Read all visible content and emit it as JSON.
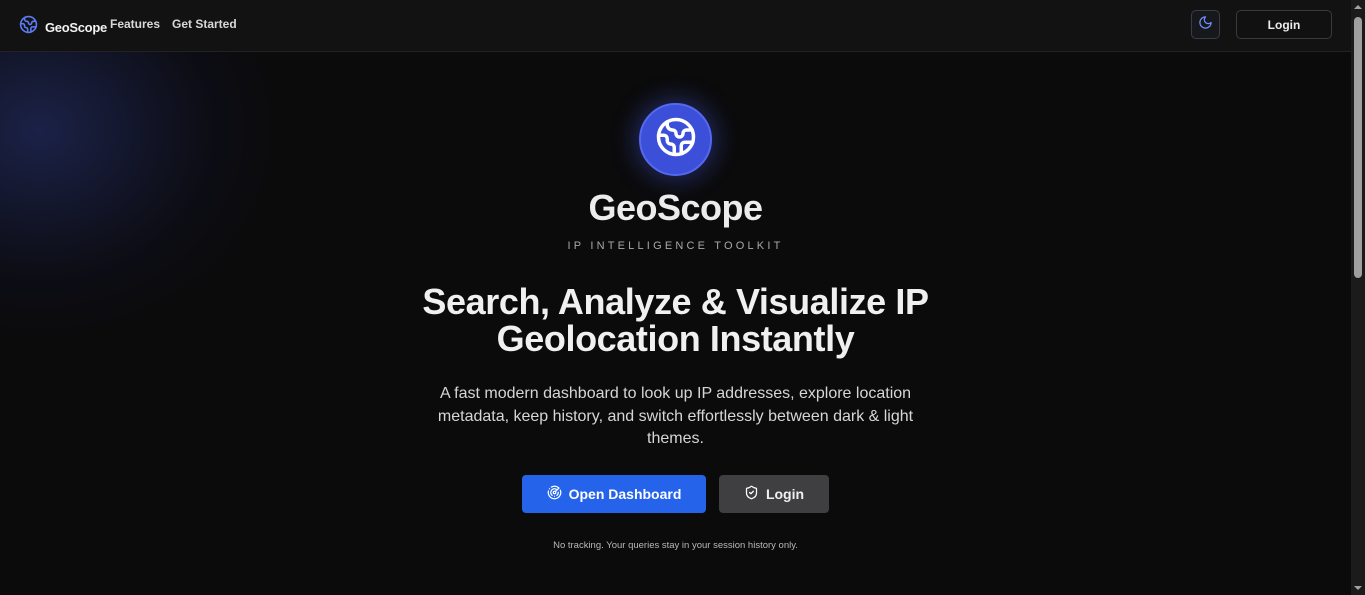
{
  "nav": {
    "brand_name": "GeoScope",
    "links": [
      {
        "label": "Features"
      },
      {
        "label": "Get Started"
      }
    ],
    "theme_toggle_icon": "moon-icon",
    "login_label": "Login"
  },
  "hero": {
    "logo_icon": "globe-icon",
    "title": "GeoScope",
    "tagline": "IP INTELLIGENCE TOOLKIT",
    "headline_line1": "Search, Analyze & Visualize IP",
    "headline_line2": "Geolocation Instantly",
    "description": "A fast modern dashboard to look up IP addresses, explore location metadata, keep history, and switch effortlessly between dark & light themes.",
    "primary_button": {
      "label": "Open Dashboard",
      "icon": "radar-icon"
    },
    "secondary_button": {
      "label": "Login",
      "icon": "shield-icon"
    },
    "footnote": "No tracking. Your queries stay in your session history only."
  },
  "colors": {
    "accent": "#2563eb",
    "logo_bg": "#3b4fd9",
    "background": "#0b0b0c"
  }
}
